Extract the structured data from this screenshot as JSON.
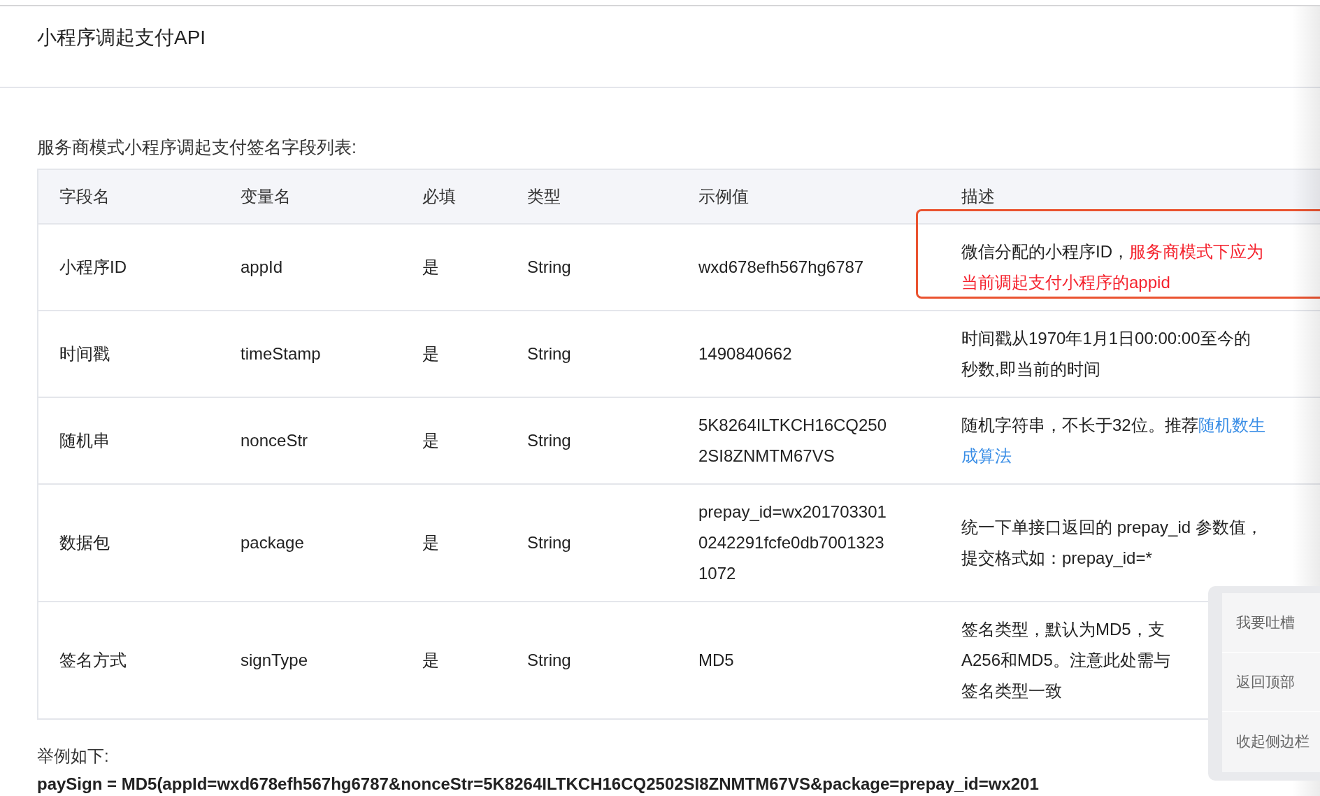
{
  "title": "小程序调起支付API",
  "caption": "服务商模式小程序调起支付签名字段列表:",
  "table": {
    "columns": [
      "字段名",
      "变量名",
      "必填",
      "类型",
      "示例值",
      "描述"
    ],
    "rows": [
      {
        "field": "小程序ID",
        "variable": "appId",
        "required": "是",
        "type": "String",
        "example": [
          "wxd678efh567hg6787"
        ],
        "highlighted": true,
        "description": [
          [
            {
              "kind": "plain",
              "text": "微信分配的小程序ID，"
            },
            {
              "kind": "emphasis",
              "text": "服务商模式下应为"
            }
          ],
          [
            {
              "kind": "emphasis",
              "text": "当前调起支付小程序的appid"
            }
          ]
        ]
      },
      {
        "field": "时间戳",
        "variable": "timeStamp",
        "required": "是",
        "type": "String",
        "example": [
          "1490840662"
        ],
        "highlighted": false,
        "description": [
          [
            {
              "kind": "plain",
              "text": "时间戳从1970年1月1日00:00:00至今的"
            }
          ],
          [
            {
              "kind": "plain",
              "text": "秒数,即当前的时间"
            }
          ]
        ]
      },
      {
        "field": "随机串",
        "variable": "nonceStr",
        "required": "是",
        "type": "String",
        "example": [
          "5K8264ILTKCH16CQ250",
          "2SI8ZNMTM67VS"
        ],
        "highlighted": false,
        "description": [
          [
            {
              "kind": "plain",
              "text": "随机字符串，不长于32位。推荐"
            },
            {
              "kind": "link",
              "text": "随机数生"
            }
          ],
          [
            {
              "kind": "link",
              "text": "成算法"
            }
          ]
        ]
      },
      {
        "field": "数据包",
        "variable": "package",
        "required": "是",
        "type": "String",
        "example": [
          "prepay_id=wx201703301",
          "0242291fcfe0db7001323",
          "1072"
        ],
        "highlighted": false,
        "description": [
          [
            {
              "kind": "plain",
              "text": "统一下单接口返回的 prepay_id 参数值，"
            }
          ],
          [
            {
              "kind": "plain",
              "text": "提交格式如：prepay_id=*"
            }
          ]
        ]
      },
      {
        "field": "签名方式",
        "variable": "signType",
        "required": "是",
        "type": "String",
        "example": [
          "MD5"
        ],
        "highlighted": false,
        "description": [
          [
            {
              "kind": "plain",
              "text": "签名类型，默认为MD5，支"
            }
          ],
          [
            {
              "kind": "plain",
              "text": "A256和MD5。注意此处需与"
            }
          ],
          [
            {
              "kind": "plain",
              "text": "签名类型一致"
            }
          ]
        ]
      }
    ]
  },
  "example_label": "举例如下:",
  "example_code": "paySign = MD5(appId=wxd678efh567hg6787&nonceStr=5K8264ILTKCH16CQ2502SI8ZNMTM67VS&package=prepay_id=wx201",
  "side_panel": [
    "我要吐槽",
    "返回顶部",
    "收起侧边栏"
  ]
}
